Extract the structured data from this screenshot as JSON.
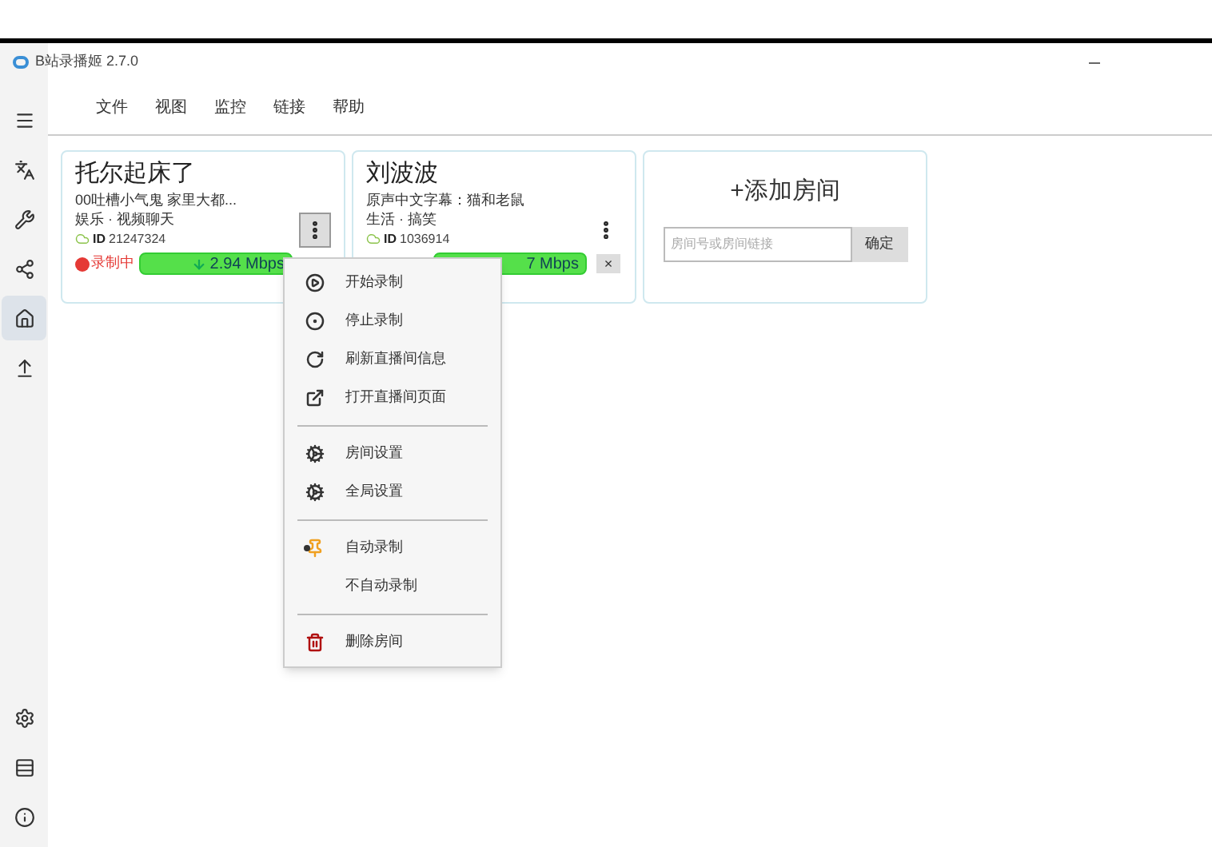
{
  "window": {
    "title": "B站录播姬 2.7.0"
  },
  "menu_bar": [
    "文件",
    "视图",
    "监控",
    "链接",
    "帮助"
  ],
  "sidebar": {
    "items": [
      {
        "kind": "menu",
        "selected": false
      },
      {
        "kind": "translate",
        "selected": false
      },
      {
        "kind": "tools",
        "selected": false
      },
      {
        "kind": "share",
        "selected": false
      },
      {
        "kind": "home",
        "selected": true
      },
      {
        "kind": "eject",
        "selected": false
      }
    ],
    "bottom": [
      {
        "kind": "settings"
      },
      {
        "kind": "logs"
      },
      {
        "kind": "info"
      }
    ]
  },
  "rooms": [
    {
      "title": "托尔起床了",
      "subtitle": "00吐槽小气鬼 家里大都...",
      "category": "娱乐 · 视频聊天",
      "id_label": "ID",
      "room_id": "21247324",
      "status": "录制中",
      "recording": true,
      "speed": "2.94 Mbps"
    },
    {
      "title": "刘波波",
      "subtitle": "原声中文字幕：猫和老鼠",
      "category": "生活 · 搞笑",
      "id_label": "ID",
      "room_id": "1036914",
      "recording": true,
      "speed": "7 Mbps",
      "close": "×"
    }
  ],
  "add_room": {
    "title": "+添加房间",
    "placeholder": "房间号或房间链接",
    "button": "确定"
  },
  "context_menu": [
    {
      "kind": "play",
      "label": "开始录制"
    },
    {
      "kind": "stop",
      "label": "停止录制"
    },
    {
      "kind": "refresh",
      "label": "刷新直播间信息"
    },
    {
      "kind": "open",
      "label": "打开直播间页面"
    },
    {
      "kind": "separator"
    },
    {
      "kind": "gear",
      "label": "房间设置"
    },
    {
      "kind": "gear",
      "label": "全局设置"
    },
    {
      "kind": "separator"
    },
    {
      "kind": "pin",
      "label": "自动录制",
      "selected": true
    },
    {
      "kind": "radio",
      "label": "不自动录制",
      "selected": false
    },
    {
      "kind": "separator"
    },
    {
      "kind": "trash",
      "label": "删除房间"
    }
  ]
}
